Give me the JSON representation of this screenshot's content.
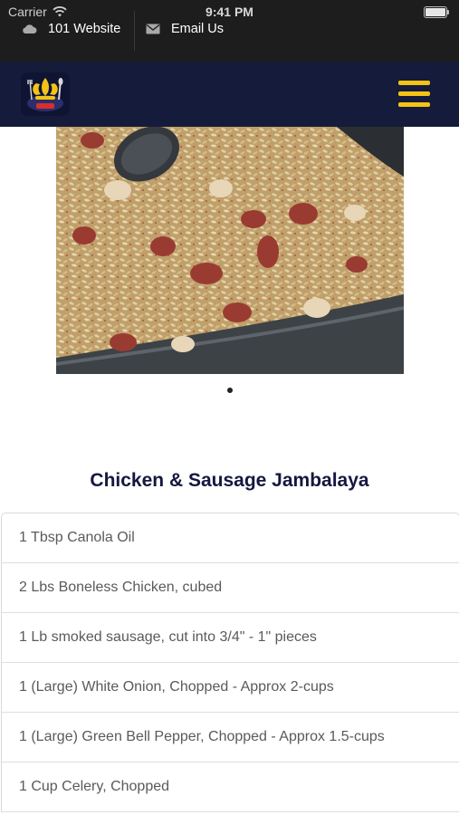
{
  "status": {
    "carrier": "Carrier",
    "time": "9:41 PM"
  },
  "toplinks": {
    "website": "101 Website",
    "email": "Email Us"
  },
  "recipe": {
    "title": "Chicken & Sausage Jambalaya",
    "ingredients": [
      "1 Tbsp Canola Oil",
      "2 Lbs Boneless Chicken, cubed",
      "1 Lb smoked sausage, cut into 3/4\" - 1\" pieces",
      "1 (Large) White Onion, Chopped - Approx 2-cups",
      "1 (Large) Green Bell Pepper, Chopped - Approx 1.5-cups",
      "1 Cup Celery, Chopped"
    ]
  },
  "colors": {
    "header_bg": "#151b3a",
    "menu_accent": "#f3c316",
    "title": "#14173f",
    "topbar_bg": "#1d1d1d"
  },
  "icons": {
    "wifi": "wifi-icon",
    "cloud": "cloud-icon",
    "mail": "mail-icon",
    "menu": "hamburger-menu-icon",
    "logo": "brand-logo"
  }
}
